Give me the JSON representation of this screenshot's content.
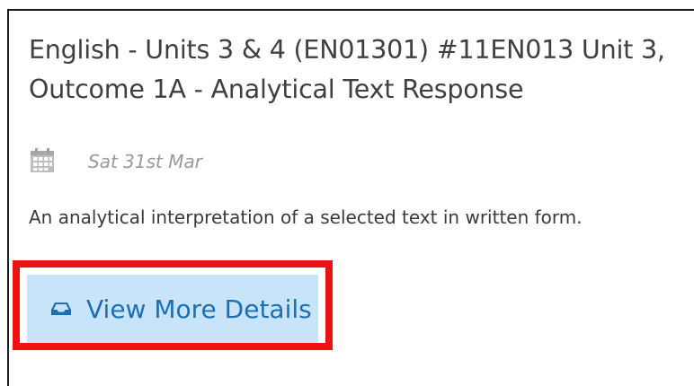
{
  "card": {
    "title": "English - Units 3 & 4 (EN01301) #11EN013 Unit 3, Outcome 1A - Analytical Text Response",
    "date": "Sat 31st Mar",
    "description": "An analytical interpretation of a selected text in written form.",
    "button_label": "View More Details",
    "icons": {
      "date": "calendar-icon",
      "button": "inbox-icon"
    }
  },
  "colors": {
    "highlight_border": "#ee1111",
    "button_background": "#c7e4fa",
    "link_text": "#1c6fb1"
  }
}
